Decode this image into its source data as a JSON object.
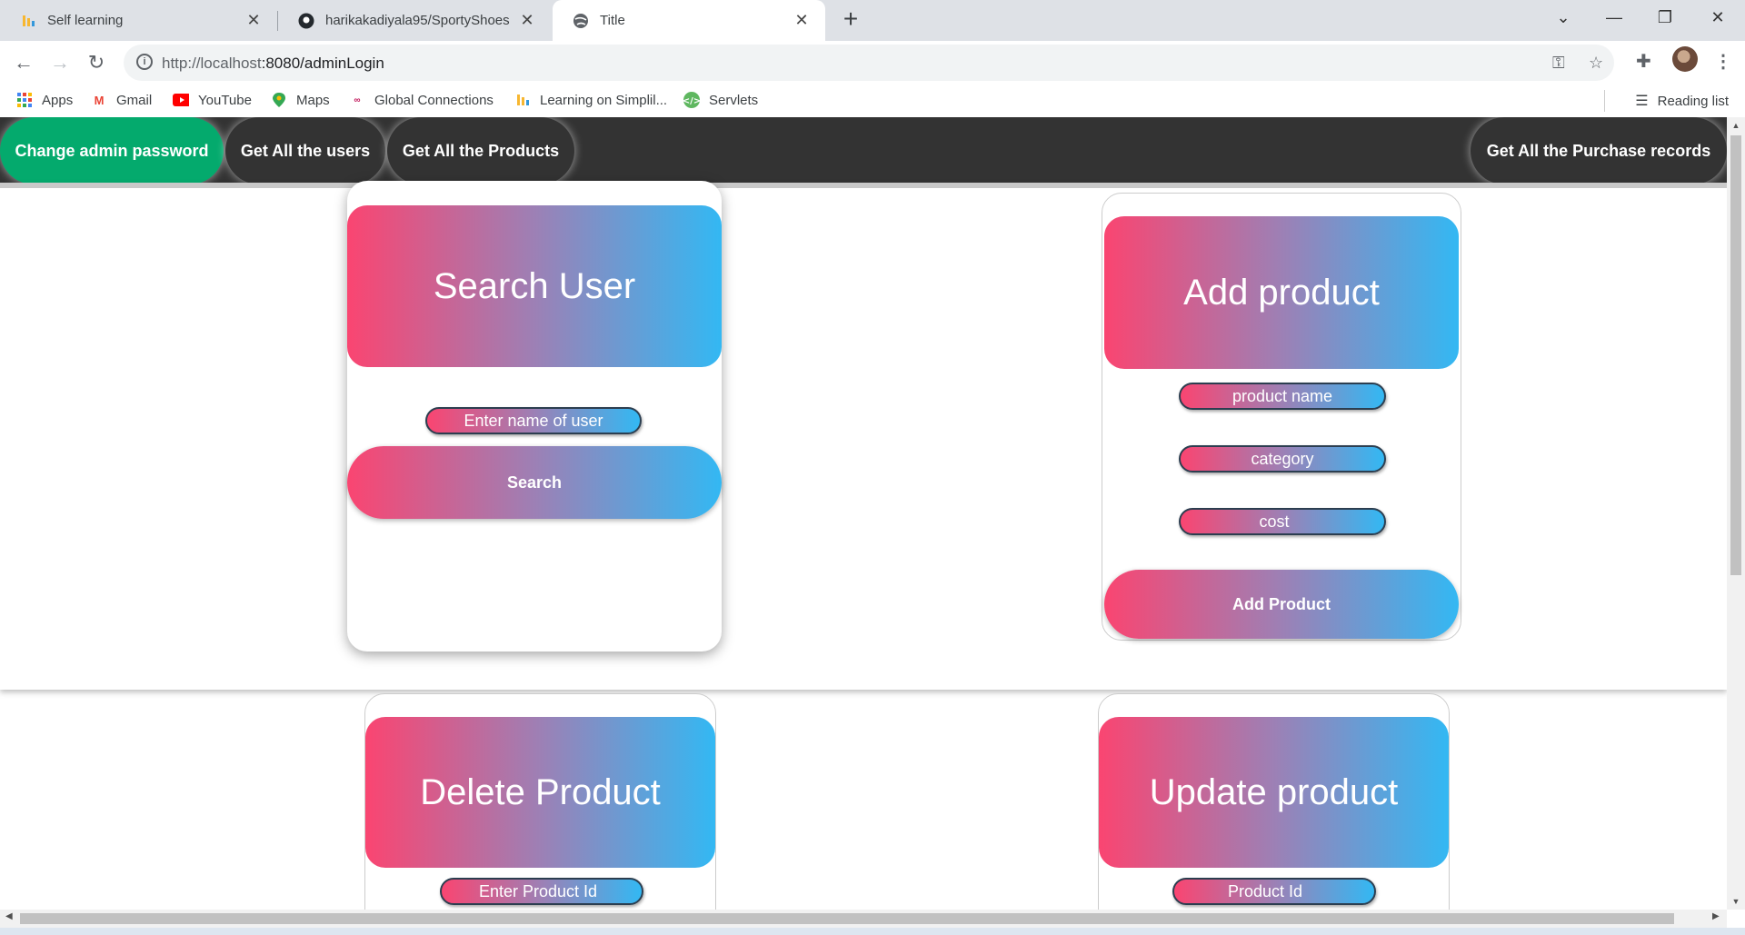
{
  "browser": {
    "tabs": [
      {
        "title": "Self learning",
        "icon": "simplilearn-icon"
      },
      {
        "title": "harikakadiyala95/SportyShoes",
        "icon": "github-icon"
      },
      {
        "title": "Title",
        "icon": "globe-icon"
      }
    ],
    "url_host": "http://localhost",
    "url_path": ":8080/adminLogin",
    "bookmarks": [
      {
        "label": "Apps",
        "icon": "apps-icon"
      },
      {
        "label": "Gmail",
        "icon": "gmail-icon"
      },
      {
        "label": "YouTube",
        "icon": "youtube-icon"
      },
      {
        "label": "Maps",
        "icon": "maps-icon"
      },
      {
        "label": "Global Connections",
        "icon": "link-icon"
      },
      {
        "label": "Learning on Simplil...",
        "icon": "simplilearn-icon"
      },
      {
        "label": "Servlets",
        "icon": "servlets-icon"
      }
    ],
    "reading_list": "Reading list"
  },
  "nav": {
    "change_password": "Change admin password",
    "get_users": "Get All the users",
    "get_products": "Get All the Products",
    "get_purchases": "Get All the Purchase records"
  },
  "search_user": {
    "title": "Search User",
    "input_placeholder": "Enter name of user",
    "button": "Search"
  },
  "add_product": {
    "title": "Add product",
    "name_placeholder": "product name",
    "category_placeholder": "category",
    "cost_placeholder": "cost",
    "button": "Add Product"
  },
  "delete_product": {
    "title": "Delete Product",
    "input_placeholder": "Enter Product Id"
  },
  "update_product": {
    "title": "Update product",
    "input_placeholder": "Product Id"
  },
  "colors": {
    "accent_green": "#04aa6d",
    "nav_bg": "#333333",
    "gradient_start": "#fa4571",
    "gradient_end": "#33b8f3"
  }
}
